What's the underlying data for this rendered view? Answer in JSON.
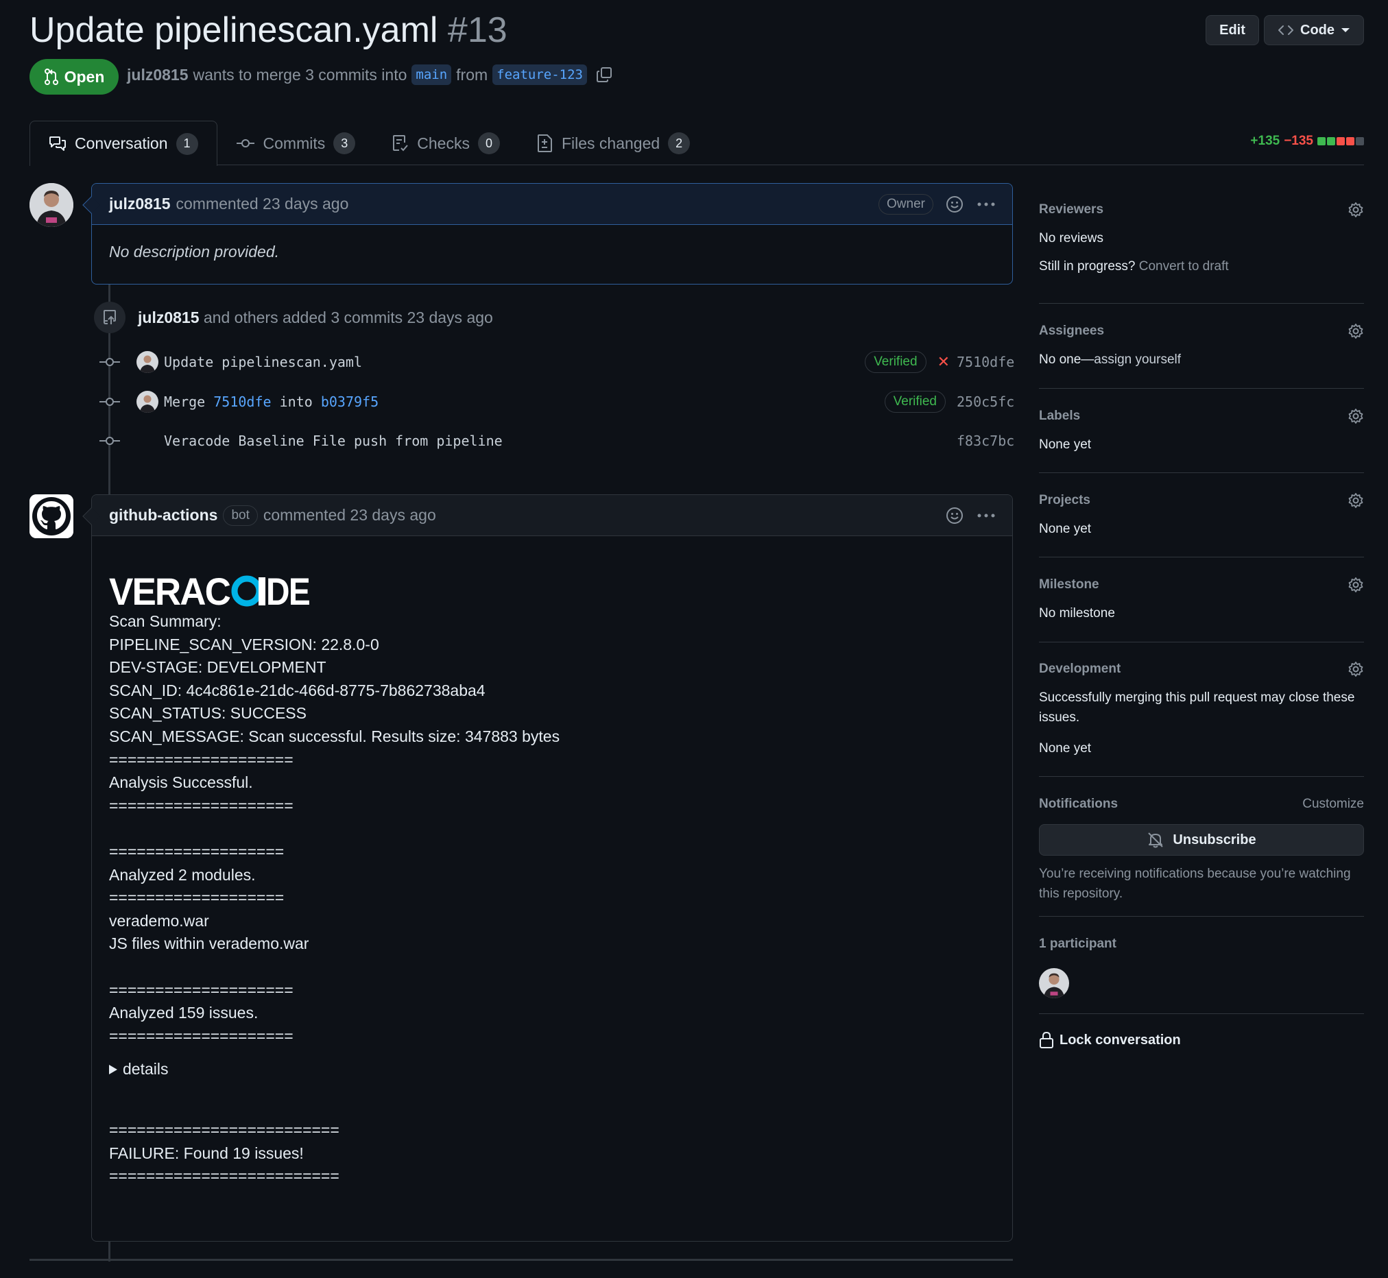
{
  "header": {
    "title": "Update pipelinescan.yaml",
    "number": "#13",
    "edit_label": "Edit",
    "code_label": "Code",
    "state": "Open",
    "author": "julz0815",
    "merge_text": "wants to merge 3 commits into",
    "base_branch": "main",
    "from_text": "from",
    "head_branch": "feature-123"
  },
  "tabs": [
    {
      "label": "Conversation",
      "count": "1",
      "icon": "comment-discussion-icon"
    },
    {
      "label": "Commits",
      "count": "3",
      "icon": "git-commit-icon"
    },
    {
      "label": "Checks",
      "count": "0",
      "icon": "checklist-icon"
    },
    {
      "label": "Files changed",
      "count": "2",
      "icon": "file-diff-icon"
    }
  ],
  "diffstat": {
    "additions": "+135",
    "deletions": "−135"
  },
  "comment1": {
    "author": "julz0815",
    "meta": "commented 23 days ago",
    "role": "Owner",
    "body": "No description provided."
  },
  "commits_event": {
    "user": "julz0815",
    "text": "and others added 3 commits 23 days ago"
  },
  "commits": [
    {
      "message": "Update pipelinescan.yaml",
      "verified": "Verified",
      "status": "failed",
      "sha": "7510dfe"
    },
    {
      "message_prefix": "Merge",
      "link1": "7510dfe",
      "message_mid": "into",
      "link2": "b0379f5",
      "verified": "Verified",
      "sha": "250c5fc"
    },
    {
      "message": "Veracode Baseline File push from pipeline",
      "sha": "f83c7bc"
    }
  ],
  "comment2": {
    "author": "github-actions",
    "badge": "bot",
    "meta": "commented 23 days ago",
    "logo_text": "VERACODE",
    "lines": [
      "Scan Summary:",
      "PIPELINE_SCAN_VERSION: 22.8.0-0",
      "DEV-STAGE: DEVELOPMENT",
      "SCAN_ID: 4c4c861e-21dc-466d-8775-7b862738aba4",
      "SCAN_STATUS: SUCCESS",
      "SCAN_MESSAGE: Scan successful. Results size: 347883 bytes",
      "====================",
      "Analysis Successful.",
      "====================",
      "",
      "===================",
      "Analyzed 2 modules.",
      "===================",
      "verademo.war",
      "JS files within verademo.war",
      "",
      "====================",
      "Analyzed 159 issues.",
      "===================="
    ],
    "details_label": "details",
    "tail_lines": [
      "=========================",
      "FAILURE: Found 19 issues!",
      "========================="
    ]
  },
  "sidebar": {
    "reviewers": {
      "title": "Reviewers",
      "value": "No reviews",
      "progress_q": "Still in progress?",
      "draft_link": "Convert to draft"
    },
    "assignees": {
      "title": "Assignees",
      "value_prefix": "No one—",
      "assign_link": "assign yourself"
    },
    "labels": {
      "title": "Labels",
      "value": "None yet"
    },
    "projects": {
      "title": "Projects",
      "value": "None yet"
    },
    "milestone": {
      "title": "Milestone",
      "value": "No milestone"
    },
    "development": {
      "title": "Development",
      "text": "Successfully merging this pull request may close these issues.",
      "value": "None yet"
    },
    "notifications": {
      "title": "Notifications",
      "customize": "Customize",
      "unsubscribe": "Unsubscribe",
      "reason": "You’re receiving notifications because you’re watching this repository."
    },
    "participants": {
      "title": "1 participant"
    },
    "lock": "Lock conversation"
  },
  "colors": {
    "open_green": "#238636",
    "link_blue": "#58a6ff",
    "danger": "#f85149",
    "success": "#3fb950",
    "veracode_o": "#00b3e6"
  }
}
